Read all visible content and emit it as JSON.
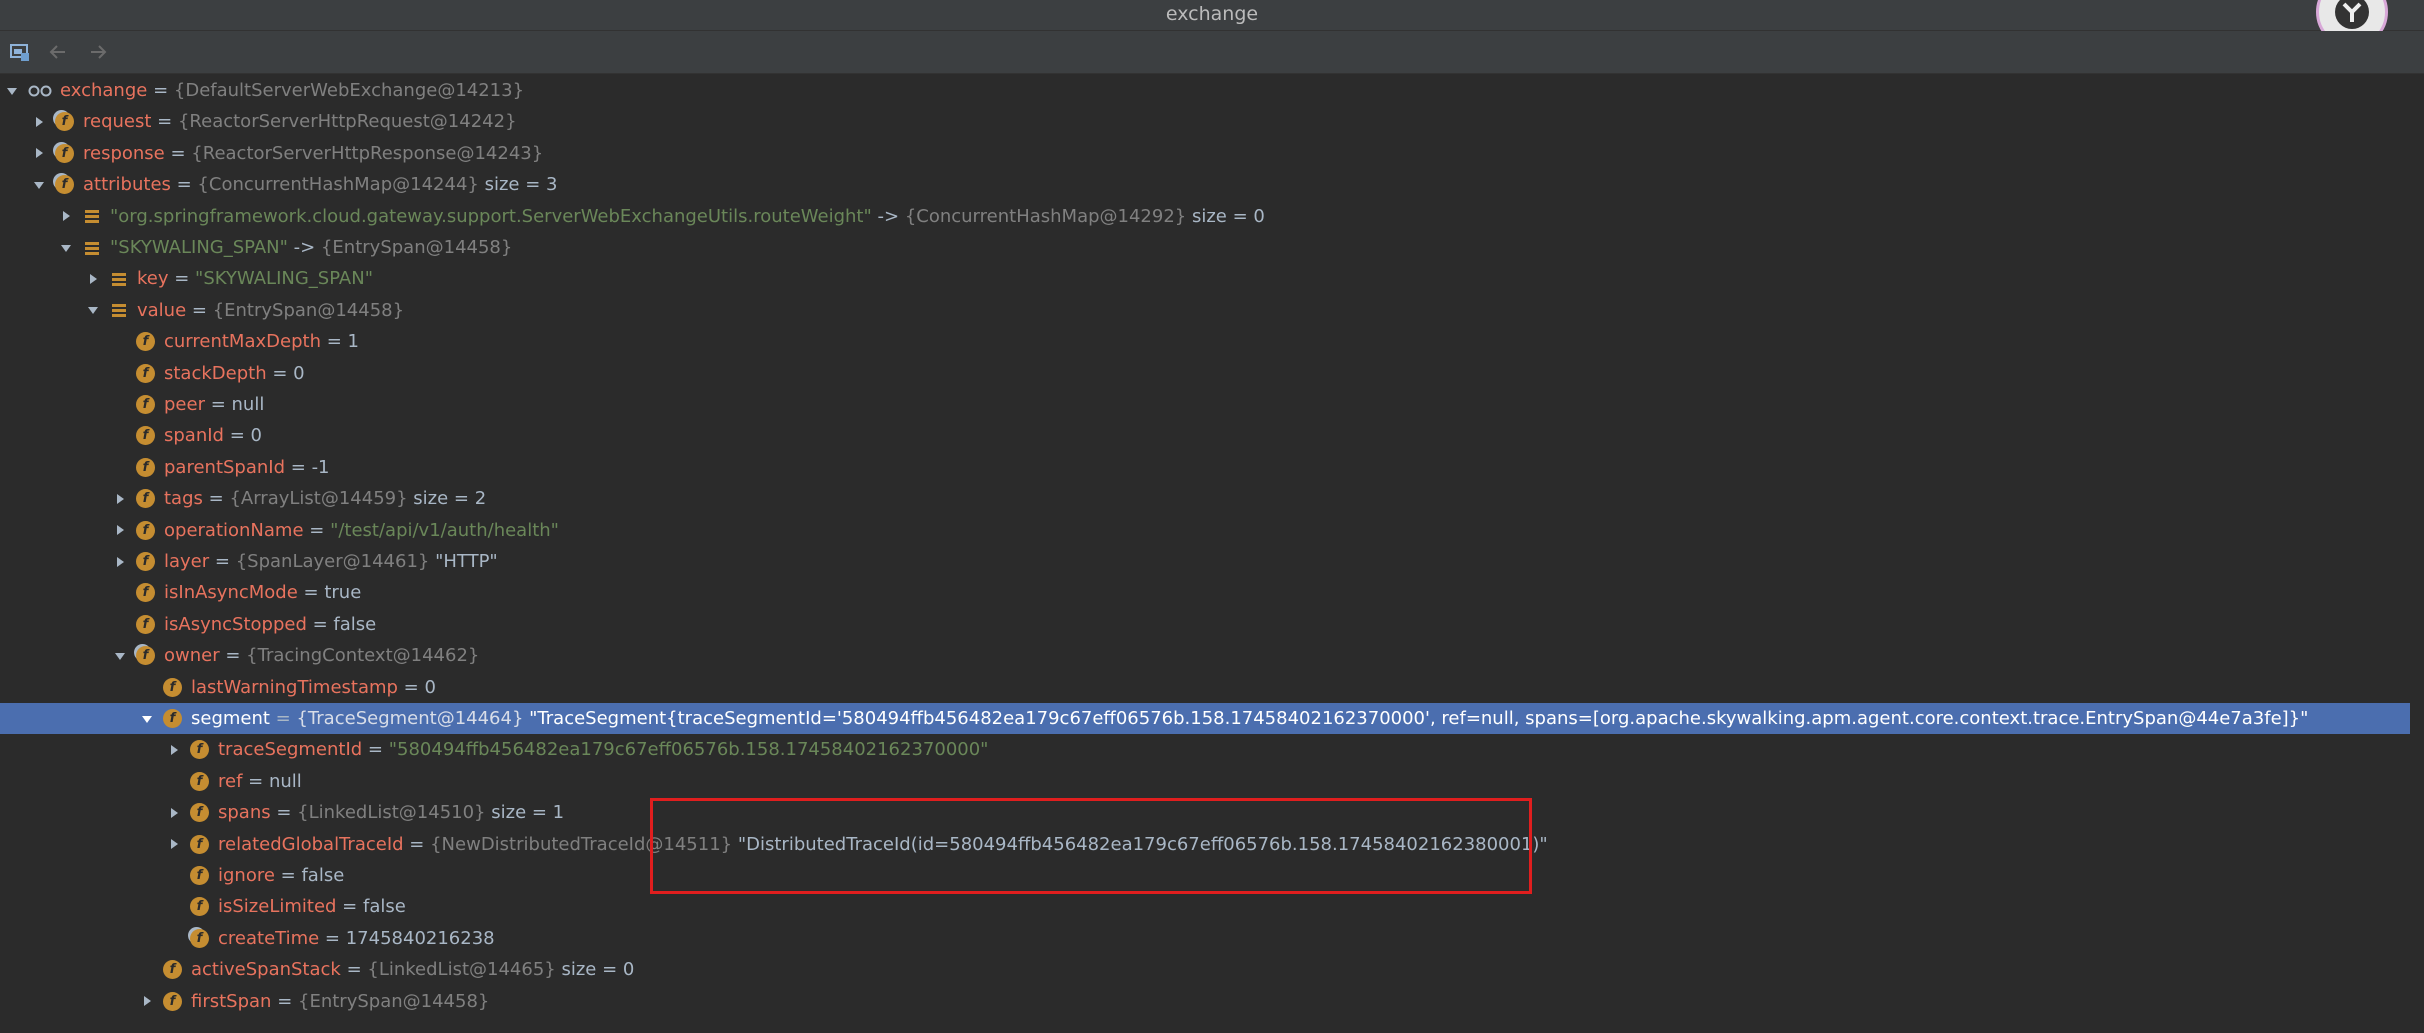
{
  "window": {
    "title": "exchange"
  },
  "toolbar": {
    "icons": [
      "restore-layout-icon",
      "back-arrow-icon",
      "forward-arrow-icon"
    ]
  },
  "colors": {
    "background": "#2b2b2b",
    "selection": "#4b6eaf",
    "field_name": "#e8735e",
    "string_value": "#6a8759",
    "type_ref": "#808080",
    "highlight_box": "#e01e1e"
  },
  "tree": [
    {
      "indent": 0,
      "arrow": "down",
      "icon": "watch",
      "name": "exchange",
      "type": "{DefaultServerWebExchange@14213}"
    },
    {
      "indent": 1,
      "arrow": "right",
      "icon": "field-locked",
      "name": "request",
      "type": "{ReactorServerHttpRequest@14242}"
    },
    {
      "indent": 1,
      "arrow": "right",
      "icon": "field-locked",
      "name": "response",
      "type": "{ReactorServerHttpResponse@14243}"
    },
    {
      "indent": 1,
      "arrow": "down",
      "icon": "field-locked",
      "name": "attributes",
      "type": "{ConcurrentHashMap@14244}",
      "extra": "size = 3"
    },
    {
      "indent": 2,
      "arrow": "right",
      "icon": "entry",
      "str": "\"org.springframework.cloud.gateway.support.ServerWebExchangeUtils.routeWeight\"",
      "arrowsym": "->",
      "type": "{ConcurrentHashMap@14292}",
      "extra": "size = 0"
    },
    {
      "indent": 2,
      "arrow": "down",
      "icon": "entry",
      "str": "\"SKYWALING_SPAN\"",
      "arrowsym": "->",
      "type": "{EntrySpan@14458}"
    },
    {
      "indent": 3,
      "arrow": "right",
      "icon": "entry",
      "name": "key",
      "str": "\"SKYWALING_SPAN\""
    },
    {
      "indent": 3,
      "arrow": "down",
      "icon": "entry",
      "name": "value",
      "type": "{EntrySpan@14458}"
    },
    {
      "indent": 4,
      "arrow": "",
      "icon": "field",
      "name": "currentMaxDepth",
      "val": "1"
    },
    {
      "indent": 4,
      "arrow": "",
      "icon": "field",
      "name": "stackDepth",
      "val": "0"
    },
    {
      "indent": 4,
      "arrow": "",
      "icon": "field",
      "name": "peer",
      "val": "null"
    },
    {
      "indent": 4,
      "arrow": "",
      "icon": "field",
      "name": "spanId",
      "val": "0"
    },
    {
      "indent": 4,
      "arrow": "",
      "icon": "field",
      "name": "parentSpanId",
      "val": "-1"
    },
    {
      "indent": 4,
      "arrow": "right",
      "icon": "field",
      "name": "tags",
      "type": "{ArrayList@14459}",
      "extra": "size = 2"
    },
    {
      "indent": 4,
      "arrow": "right",
      "icon": "field",
      "name": "operationName",
      "str": "\"/test/api/v1/auth/health\""
    },
    {
      "indent": 4,
      "arrow": "right",
      "icon": "field",
      "name": "layer",
      "type": "{SpanLayer@14461}",
      "val": "\"HTTP\""
    },
    {
      "indent": 4,
      "arrow": "",
      "icon": "field",
      "name": "isInAsyncMode",
      "val": "true"
    },
    {
      "indent": 4,
      "arrow": "",
      "icon": "field",
      "name": "isAsyncStopped",
      "val": "false"
    },
    {
      "indent": 4,
      "arrow": "down",
      "icon": "field-locked",
      "name": "owner",
      "type": "{TracingContext@14462}"
    },
    {
      "indent": 5,
      "arrow": "",
      "icon": "field",
      "name": "lastWarningTimestamp",
      "val": "0"
    },
    {
      "indent": 5,
      "arrow": "down",
      "icon": "field",
      "name": "segment",
      "type": "{TraceSegment@14464}",
      "val": "\"TraceSegment{traceSegmentId='580494ffb456482ea179c67eff06576b.158.17458402162370000', ref=null, spans=[org.apache.skywalking.apm.agent.core.context.trace.EntrySpan@44e7a3fe]}\"",
      "selected": true
    },
    {
      "indent": 6,
      "arrow": "right",
      "icon": "field",
      "name": "traceSegmentId",
      "str": "\"580494ffb456482ea179c67eff06576b.158.17458402162370000\""
    },
    {
      "indent": 6,
      "arrow": "",
      "icon": "field",
      "name": "ref",
      "val": "null"
    },
    {
      "indent": 6,
      "arrow": "right",
      "icon": "field",
      "name": "spans",
      "type": "{LinkedList@14510}",
      "extra": "size = 1"
    },
    {
      "indent": 6,
      "arrow": "right",
      "icon": "field",
      "name": "relatedGlobalTraceId",
      "type": "{NewDistributedTraceId@14511}",
      "val": "\"DistributedTraceId(id=580494ffb456482ea179c67eff06576b.158.17458402162380001)\""
    },
    {
      "indent": 6,
      "arrow": "",
      "icon": "field",
      "name": "ignore",
      "val": "false"
    },
    {
      "indent": 6,
      "arrow": "",
      "icon": "field",
      "name": "isSizeLimited",
      "val": "false"
    },
    {
      "indent": 6,
      "arrow": "",
      "icon": "field-locked",
      "name": "createTime",
      "val": "1745840216238"
    },
    {
      "indent": 5,
      "arrow": "",
      "icon": "field",
      "name": "activeSpanStack",
      "type": "{LinkedList@14465}",
      "extra": "size = 0"
    },
    {
      "indent": 5,
      "arrow": "right",
      "icon": "field",
      "name": "firstSpan",
      "type": "{EntrySpan@14458}"
    }
  ]
}
